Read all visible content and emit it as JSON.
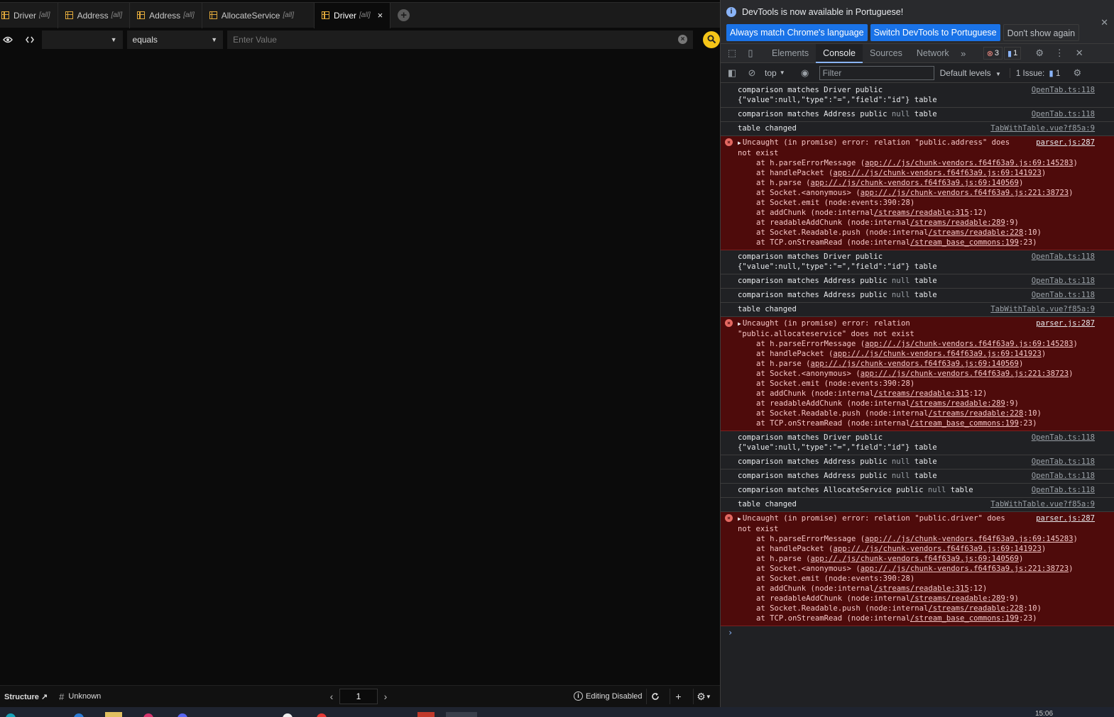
{
  "app": {
    "tabs": [
      {
        "label": "Driver",
        "sub": "[all]"
      },
      {
        "label": "Address",
        "sub": "[all]"
      },
      {
        "label": "Address",
        "sub": "[all]"
      },
      {
        "label": "AllocateService",
        "sub": "[all]"
      },
      {
        "label": "Driver",
        "sub": "[all]",
        "close": "×"
      }
    ],
    "filter": {
      "column_value": "",
      "operator_value": "equals",
      "value_placeholder": "Enter Value"
    },
    "status": {
      "structure_label": "Structure ↗",
      "unknown_label": "Unknown",
      "page": "1",
      "editing_label": "Editing Disabled"
    }
  },
  "devtools": {
    "info_message": "DevTools is now available in Portuguese!",
    "btn_match": "Always match Chrome's language",
    "btn_switch": "Switch DevTools to Portuguese",
    "btn_dont_show": "Don't show again",
    "tabs": [
      "Elements",
      "Console",
      "Sources",
      "Network"
    ],
    "error_count": "3",
    "message_count": "1",
    "context": "top",
    "filter_placeholder": "Filter",
    "levels": "Default levels",
    "issues": "1 Issue:",
    "issues_count": "1",
    "log": [
      {
        "type": "log",
        "html": "comparison matches Driver public\n{\"value\":null,\"type\":\"=\",\"field\":\"id\"} table",
        "src": "OpenTab.ts:118"
      },
      {
        "type": "log",
        "pre": "comparison matches Address public ",
        "null": "null",
        "post": " table",
        "src": "OpenTab.ts:118"
      },
      {
        "type": "log",
        "html": "table changed",
        "src": "TabWithTable.vue?f85a:9"
      },
      {
        "type": "err",
        "msg": "Uncaught (in promise) error: relation \"public.address\" does\nnot exist",
        "src": "parser.js:287"
      },
      {
        "type": "log",
        "html": "comparison matches Driver public\n{\"value\":null,\"type\":\"=\",\"field\":\"id\"} table",
        "src": "OpenTab.ts:118"
      },
      {
        "type": "log",
        "pre": "comparison matches Address public ",
        "null": "null",
        "post": " table",
        "src": "OpenTab.ts:118"
      },
      {
        "type": "log",
        "pre": "comparison matches Address public ",
        "null": "null",
        "post": " table",
        "src": "OpenTab.ts:118"
      },
      {
        "type": "log",
        "html": "table changed",
        "src": "TabWithTable.vue?f85a:9"
      },
      {
        "type": "err",
        "msg": "Uncaught (in promise) error: relation\n\"public.allocateservice\" does not exist",
        "src": "parser.js:287"
      },
      {
        "type": "log",
        "html": "comparison matches Driver public\n{\"value\":null,\"type\":\"=\",\"field\":\"id\"} table",
        "src": "OpenTab.ts:118"
      },
      {
        "type": "log",
        "pre": "comparison matches Address public ",
        "null": "null",
        "post": " table",
        "src": "OpenTab.ts:118"
      },
      {
        "type": "log",
        "pre": "comparison matches Address public ",
        "null": "null",
        "post": " table",
        "src": "OpenTab.ts:118"
      },
      {
        "type": "log",
        "pre": "comparison matches AllocateService public ",
        "null": "null",
        "post": " table",
        "src": "OpenTab.ts:118"
      },
      {
        "type": "log",
        "html": "table changed",
        "src": "TabWithTable.vue?f85a:9"
      },
      {
        "type": "err",
        "msg": "Uncaught (in promise) error: relation \"public.driver\" does\nnot exist",
        "src": "parser.js:287"
      }
    ],
    "stack": [
      {
        "pre": "at h.parseErrorMessage (",
        "link": "app://./js/chunk-vendors.f64f63a9.js:69:145283",
        "post": ")"
      },
      {
        "pre": "at handlePacket (",
        "link": "app://./js/chunk-vendors.f64f63a9.js:69:141923",
        "post": ")"
      },
      {
        "pre": "at h.parse (",
        "link": "app://./js/chunk-vendors.f64f63a9.js:69:140569",
        "post": ")"
      },
      {
        "pre": "at Socket.<anonymous> (",
        "link": "app://./js/chunk-vendors.f64f63a9.js:221:38723",
        "post": ")"
      },
      {
        "pre": "at Socket.emit (node:events:390:28)",
        "link": "",
        "post": ""
      },
      {
        "pre": "at addChunk (node:internal",
        "link": "/streams/readable:315",
        "post": ":12)"
      },
      {
        "pre": "at readableAddChunk (node:internal",
        "link": "/streams/readable:289",
        "post": ":9)"
      },
      {
        "pre": "at Socket.Readable.push (node:internal",
        "link": "/streams/readable:228",
        "post": ":10)"
      },
      {
        "pre": "at TCP.onStreamRead (node:internal",
        "link": "/stream_base_commons:199",
        "post": ":23)"
      }
    ],
    "prompt": "›"
  },
  "taskbar": {
    "time": "15:06"
  }
}
